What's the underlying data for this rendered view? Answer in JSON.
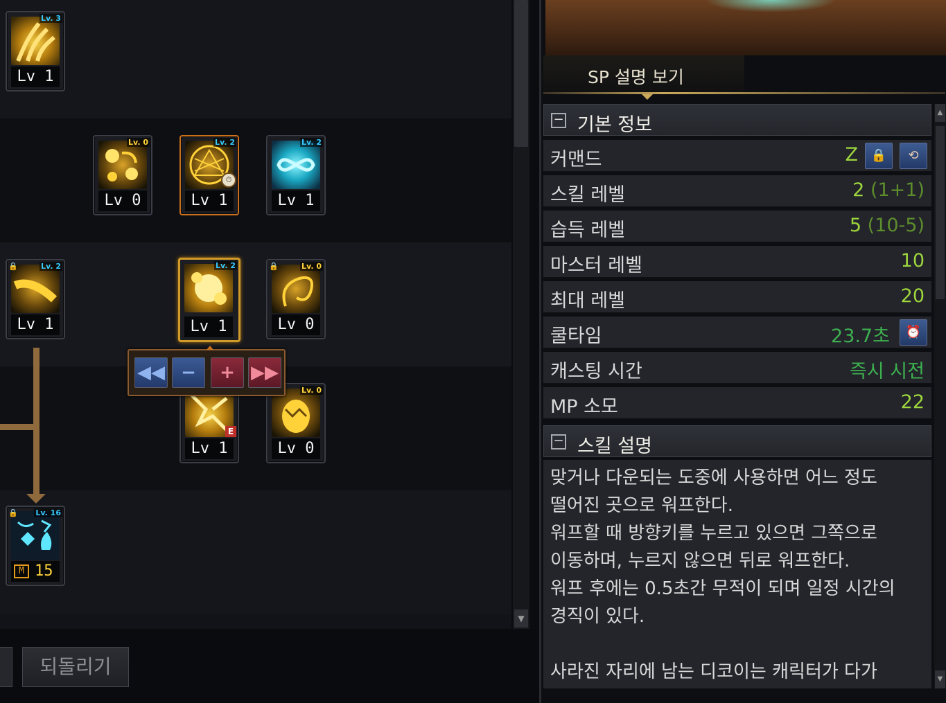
{
  "skill_tree": {
    "skills": [
      {
        "id": "s1",
        "tag": "Lv. 3",
        "tag_color": "cyan",
        "level_label": "Lv 1",
        "icon": "golden-claws-icon",
        "locked": false
      },
      {
        "id": "s2",
        "tag": "Lv. 0",
        "tag_color": "gold",
        "level_label": "Lv 0",
        "icon": "golden-orbs-icon",
        "locked": false
      },
      {
        "id": "s3",
        "tag": "Lv. 2",
        "tag_color": "cyan",
        "level_label": "Lv 1",
        "icon": "golden-sigil-icon",
        "locked": false,
        "has_cooldown": true
      },
      {
        "id": "s4",
        "tag": "Lv. 2",
        "tag_color": "cyan",
        "level_label": "Lv 1",
        "icon": "cyan-knot-icon",
        "locked": false
      },
      {
        "id": "s5",
        "tag": "Lv. 2",
        "tag_color": "cyan",
        "level_label": "Lv 1",
        "icon": "golden-swoop-icon",
        "locked": true
      },
      {
        "id": "s6",
        "tag": "Lv. 2",
        "tag_color": "cyan",
        "level_label": "Lv 1",
        "icon": "golden-burst-icon",
        "locked": false,
        "selected": true
      },
      {
        "id": "s7",
        "tag": "Lv. 0",
        "tag_color": "gold",
        "level_label": "Lv 0",
        "icon": "golden-whip-icon",
        "locked": true
      },
      {
        "id": "s8",
        "tag": "",
        "tag_color": "cyan",
        "level_label": "Lv 1",
        "icon": "golden-shards-icon",
        "locked": false,
        "badge": "E"
      },
      {
        "id": "s9",
        "tag": "Lv. 0",
        "tag_color": "gold",
        "level_label": "Lv 0",
        "icon": "golden-egg-icon",
        "locked": false
      },
      {
        "id": "s10",
        "tag": "Lv. 16",
        "tag_color": "cyan",
        "level_label": "15",
        "icon": "cyan-elements-icon",
        "locked": true,
        "master_badge": "M"
      }
    ],
    "level_controls": {
      "min_label": "◀◀",
      "minus_label": "−",
      "plus_label": "+",
      "max_label": "▶▶"
    },
    "undo_label": "되돌리기"
  },
  "detail": {
    "tab_label": "SP 설명 보기",
    "basic_info": {
      "title": "기본 정보",
      "toggle": "−",
      "rows": [
        {
          "key": "커맨드",
          "value": "Z",
          "value_dim": "",
          "buttons": [
            "lock-icon",
            "swap-icon"
          ]
        },
        {
          "key": "스킬 레벨",
          "value": "2",
          "value_dim": " (1+1)"
        },
        {
          "key": "습득 레벨",
          "value": "5",
          "value_dim": " (10-5)"
        },
        {
          "key": "마스터 레벨",
          "value": "10",
          "value_dim": ""
        },
        {
          "key": "최대 레벨",
          "value": "20",
          "value_dim": ""
        },
        {
          "key": "쿨타임",
          "value": "23.7초",
          "value_dim": "",
          "buttons": [
            "alarm-clock-icon"
          ]
        },
        {
          "key": "캐스팅 시간",
          "value": "즉시 시전",
          "value_dim": ""
        },
        {
          "key": "MP 소모",
          "value": "22",
          "value_dim": ""
        }
      ]
    },
    "skill_desc": {
      "title": "스킬 설명",
      "toggle": "−",
      "text": "맞거나 다운되는 도중에 사용하면 어느 정도\n떨어진 곳으로 워프한다.\n워프할 때 방향키를 누르고 있으면 그쪽으로\n이동하며, 누르지 않으면 뒤로 워프한다.\n워프 후에는 0.5초간 무적이 되며 일정 시간의\n경직이 있다.\n\n사라진 자리에 남는 디코이는 캐릭터가 다가"
    }
  },
  "colors": {
    "value_green": "#9ed63c",
    "cyan_tag": "#36c8ff",
    "gold_tag": "#ffd23a",
    "selected_border": "#d19b2a"
  }
}
